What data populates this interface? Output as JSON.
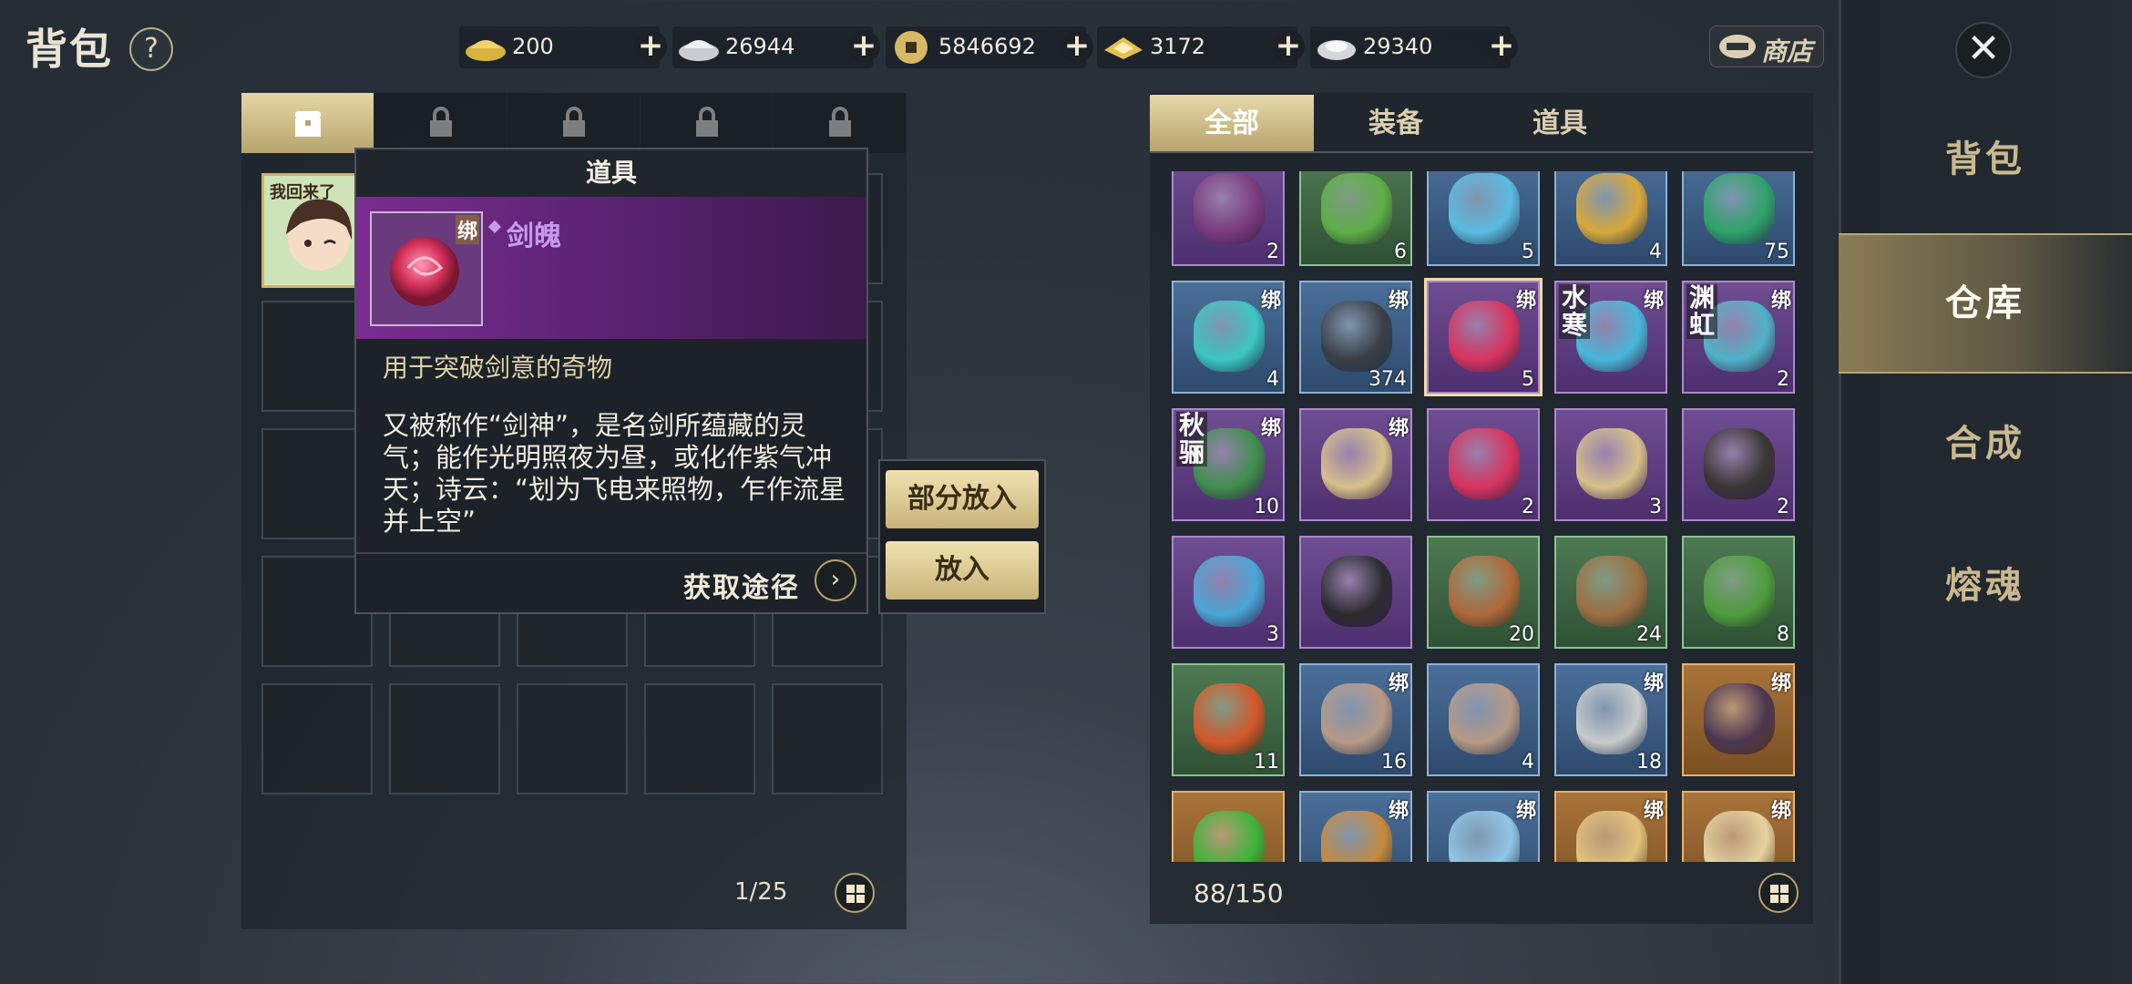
{
  "header": {
    "title": "背包",
    "help_symbol": "?",
    "currencies": [
      {
        "icon": "gold-ingot-icon",
        "value": "200"
      },
      {
        "icon": "silver-ingot-icon",
        "value": "26944"
      },
      {
        "icon": "copper-coin-icon",
        "value": "5846692"
      },
      {
        "icon": "gold-ticket-icon",
        "value": "3172"
      },
      {
        "icon": "silver-ticket-icon",
        "value": "29340"
      }
    ],
    "plus_symbol": "+",
    "shop_label": "商店"
  },
  "sidenav": {
    "close_symbol": "✕",
    "items": [
      {
        "label": "背包",
        "active": false
      },
      {
        "label": "仓库",
        "active": true
      },
      {
        "label": "合成",
        "active": false
      },
      {
        "label": "熔魂",
        "active": false
      }
    ]
  },
  "left_panel": {
    "tabs": [
      "chest-icon",
      "lock-icon",
      "lock-icon",
      "lock-icon",
      "lock-icon"
    ],
    "avatar_caption": "我回来了",
    "count": "1/25"
  },
  "tooltip": {
    "header": "道具",
    "bind_tag": "绑",
    "item_name": "剑魄",
    "subtitle": "用于突破剑意的奇物",
    "description": "又被称作“剑神”，是名剑所蕴藏的灵气；能作光明照夜为昼，或化作紫气冲天；诗云：“划为飞电来照物，乍作流星并上空”",
    "source_label": "获取途径",
    "source_arrow": "›"
  },
  "actions": {
    "partial_label": "部分放入",
    "put_label": "放入"
  },
  "right_panel": {
    "tabs": [
      {
        "label": "全部",
        "active": true
      },
      {
        "label": "装备",
        "active": false
      },
      {
        "label": "道具",
        "active": false
      }
    ],
    "count": "88/150",
    "items": [
      [
        {
          "rarity": "purple",
          "count": "2",
          "bind": "",
          "tag": "",
          "art": "#7b3b7d"
        },
        {
          "rarity": "green",
          "count": "6",
          "bind": "",
          "tag": "",
          "art": "#5fae48"
        },
        {
          "rarity": "blue",
          "count": "5",
          "bind": "",
          "tag": "",
          "art": "#5bbbe0"
        },
        {
          "rarity": "blue",
          "count": "4",
          "bind": "",
          "tag": "",
          "art": "#d9a93b"
        },
        {
          "rarity": "blue",
          "count": "75",
          "bind": "",
          "tag": "",
          "art": "#2fa36a"
        }
      ],
      [
        {
          "rarity": "blue",
          "count": "4",
          "bind": "绑",
          "tag": "",
          "art": "#3cc6c2"
        },
        {
          "rarity": "blue",
          "count": "374",
          "bind": "绑",
          "tag": "",
          "art": "#3a3f45"
        },
        {
          "rarity": "purple",
          "count": "5",
          "bind": "绑",
          "tag": "",
          "art": "#d8345e",
          "selected": true
        },
        {
          "rarity": "purple",
          "count": "",
          "bind": "绑",
          "tag": "水寒",
          "art": "#49b7d9"
        },
        {
          "rarity": "purple",
          "count": "2",
          "bind": "绑",
          "tag": "渊虹",
          "art": "#4fb2c7"
        }
      ],
      [
        {
          "rarity": "purple",
          "count": "10",
          "bind": "绑",
          "tag": "秋骊",
          "art": "#3f8f4c"
        },
        {
          "rarity": "purple",
          "count": "",
          "bind": "绑",
          "tag": "",
          "art": "#d7c08a"
        },
        {
          "rarity": "purple",
          "count": "2",
          "bind": "",
          "tag": "",
          "art": "#d8345e"
        },
        {
          "rarity": "purple",
          "count": "3",
          "bind": "",
          "tag": "",
          "art": "#d7c08a"
        },
        {
          "rarity": "purple",
          "count": "2",
          "bind": "",
          "tag": "",
          "art": "#3a3634"
        }
      ],
      [
        {
          "rarity": "purple",
          "count": "3",
          "bind": "",
          "tag": "",
          "art": "#4aa6d6"
        },
        {
          "rarity": "purple",
          "count": "",
          "bind": "",
          "tag": "",
          "art": "#2b2b2e"
        },
        {
          "rarity": "green",
          "count": "20",
          "bind": "",
          "tag": "",
          "art": "#b0683a"
        },
        {
          "rarity": "green",
          "count": "24",
          "bind": "",
          "tag": "",
          "art": "#9b7043"
        },
        {
          "rarity": "green",
          "count": "8",
          "bind": "",
          "tag": "",
          "art": "#4e9d3e"
        }
      ],
      [
        {
          "rarity": "green",
          "count": "11",
          "bind": "",
          "tag": "",
          "art": "#d3582a"
        },
        {
          "rarity": "blue",
          "count": "16",
          "bind": "绑",
          "tag": "",
          "art": "#b79a86"
        },
        {
          "rarity": "blue",
          "count": "4",
          "bind": "",
          "tag": "",
          "art": "#b79a86"
        },
        {
          "rarity": "blue",
          "count": "18",
          "bind": "绑",
          "tag": "",
          "art": "#c8cbcc"
        },
        {
          "rarity": "orange",
          "count": "",
          "bind": "绑",
          "tag": "",
          "art": "#4c3650"
        }
      ],
      [
        {
          "rarity": "orange",
          "count": "",
          "bind": "",
          "tag": "",
          "art": "#3db43a"
        },
        {
          "rarity": "blue",
          "count": "",
          "bind": "绑",
          "tag": "",
          "art": "#c78a3b"
        },
        {
          "rarity": "blue",
          "count": "",
          "bind": "绑",
          "tag": "",
          "art": "#8fc7e6"
        },
        {
          "rarity": "orange",
          "count": "",
          "bind": "绑",
          "tag": "",
          "art": "#e2c27d"
        },
        {
          "rarity": "orange",
          "count": "",
          "bind": "绑",
          "tag": "",
          "art": "#e6d2a0"
        }
      ]
    ]
  }
}
